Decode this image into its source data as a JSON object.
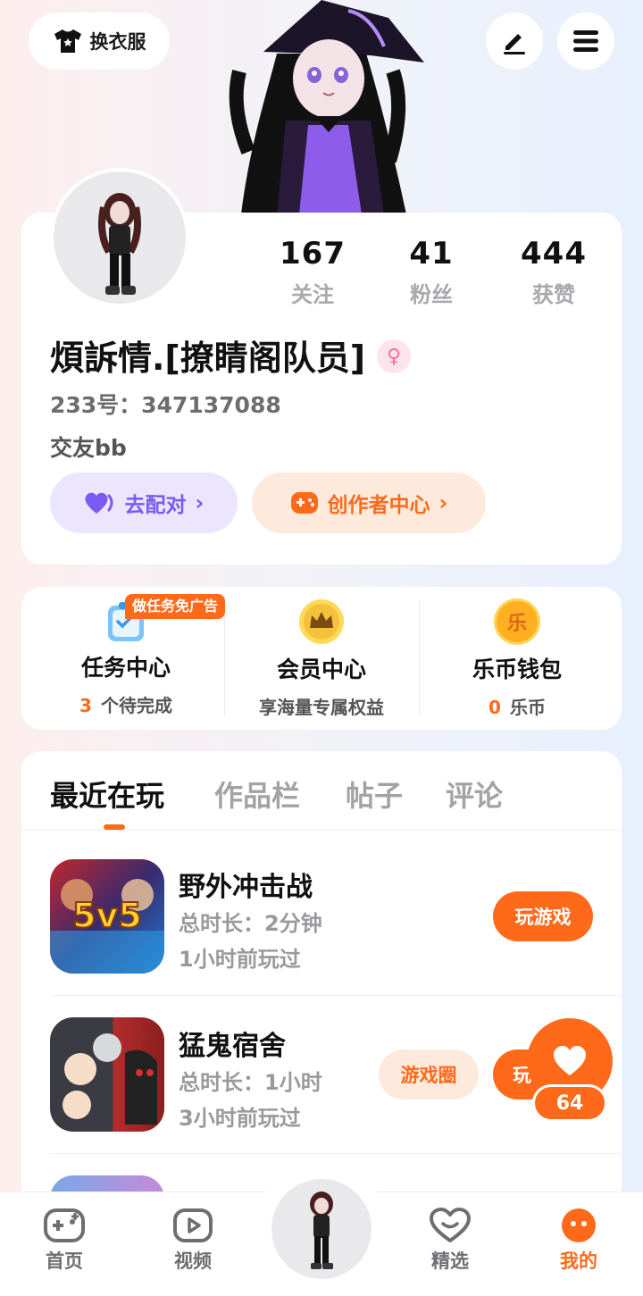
{
  "header": {
    "outfit_label": "换衣服"
  },
  "profile": {
    "stats": [
      {
        "value": "167",
        "label": "关注"
      },
      {
        "value": "41",
        "label": "粉丝"
      },
      {
        "value": "444",
        "label": "获赞"
      }
    ],
    "username": "煩訴情.[撩睛阁队员]",
    "gender_symbol": "♀",
    "uid": "233号：347137088",
    "bio": "交友bb",
    "pair_label": "去配对",
    "creator_label": "创作者中心",
    "chevron": "›"
  },
  "services": {
    "promo_badge": "做任务免广告",
    "items": [
      {
        "title": "任务中心",
        "count": "3",
        "sub": "个待完成"
      },
      {
        "title": "会员中心",
        "count": "",
        "sub": "享海量专属权益"
      },
      {
        "title": "乐币钱包",
        "count": "0",
        "sub": "乐币"
      }
    ],
    "coin_glyph": "乐"
  },
  "recent": {
    "tabs": [
      "最近在玩",
      "作品栏",
      "帖子",
      "评论"
    ],
    "games": [
      {
        "name": "野外冲击战",
        "duration": "总时长：2分钟",
        "last_played": "1小时前玩过",
        "play_label": "玩游戏",
        "icon_text": "5v5"
      },
      {
        "name": "猛鬼宿舍",
        "duration": "总时长：1小时",
        "last_played": "3小时前玩过",
        "circle_label": "游戏圈",
        "play_label": "玩"
      }
    ]
  },
  "like_float": {
    "count": "64"
  },
  "nav": {
    "items": [
      {
        "label": "首页"
      },
      {
        "label": "视频"
      },
      {
        "label": "精选"
      },
      {
        "label": "我的"
      }
    ]
  },
  "colors": {
    "accent": "#ff6a1a",
    "purple": "#7a5af5",
    "muted": "#a3a3a7"
  }
}
